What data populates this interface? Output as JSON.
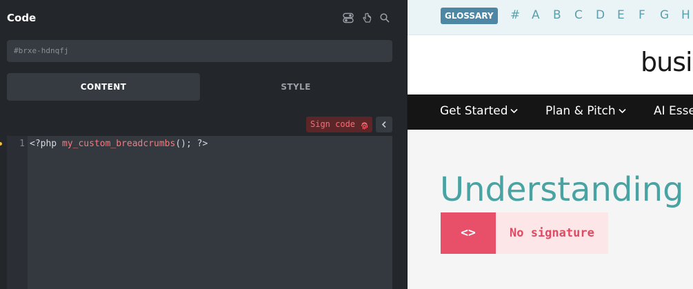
{
  "panel": {
    "title": "Code",
    "header_icons": [
      "toggle-icon",
      "pointer-icon",
      "search-icon"
    ],
    "element_id": "#brxe-hdnqfj",
    "tabs": [
      {
        "label": "CONTENT",
        "active": true
      },
      {
        "label": "STYLE",
        "active": false
      }
    ],
    "sign_code_label": "Sign code",
    "editor": {
      "line_number": "1",
      "code_prefix": "<?php ",
      "code_function": "my_custom_breadcrumbs",
      "code_suffix": "(); ?>"
    }
  },
  "preview": {
    "glossary_label": "GLOSSARY",
    "letters": [
      "#",
      "A",
      "B",
      "C",
      "D",
      "E",
      "F",
      "G",
      "H"
    ],
    "logo_text": "busi",
    "nav": [
      "Get Started",
      "Plan & Pitch",
      "AI Esse"
    ],
    "hero_title": "Understanding",
    "signature_icon": "<>",
    "signature_label": "No signature"
  },
  "colors": {
    "panel_bg": "#23262a",
    "accent_red": "#e8506a",
    "teal": "#4aa3a3",
    "glossary_blue": "#4e87a4"
  }
}
